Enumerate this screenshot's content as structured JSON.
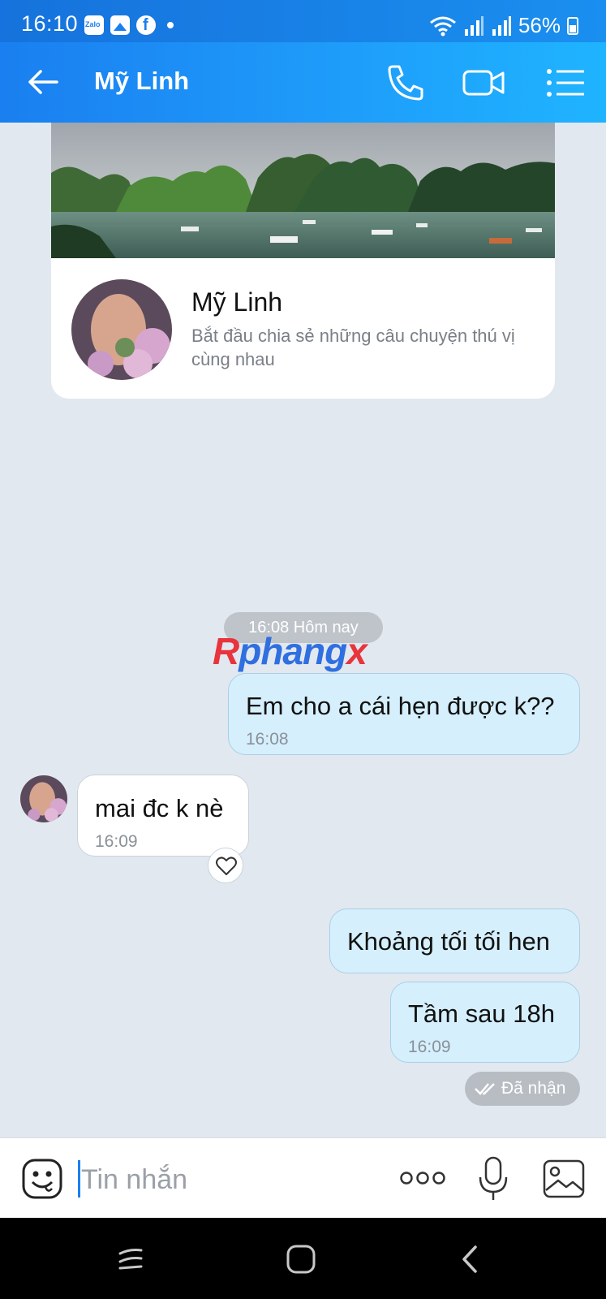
{
  "status_bar": {
    "time": "16:10",
    "battery": "56%",
    "notification_icons": [
      "zalo-icon",
      "gallery-icon",
      "facebook-icon"
    ]
  },
  "header": {
    "title": "Mỹ Linh"
  },
  "profile_card": {
    "name": "Mỹ Linh",
    "subtitle": "Bắt đầu chia sẻ những câu chuyện thú vị cùng nhau"
  },
  "chat": {
    "date_separator": "16:08 Hôm nay",
    "watermark": {
      "part1": "R",
      "part2": "phang",
      "part3": "x"
    },
    "messages": [
      {
        "direction": "outgoing",
        "text": "Em cho a cái hẹn được k??",
        "time": "16:08"
      },
      {
        "direction": "incoming",
        "text": "mai đc k nè",
        "time": "16:09"
      },
      {
        "direction": "outgoing",
        "text": "Khoảng tối tối hen",
        "time": ""
      },
      {
        "direction": "outgoing",
        "text": "Tầm sau 18h",
        "time": "16:09"
      }
    ],
    "delivery_status": "Đã nhận"
  },
  "input_bar": {
    "placeholder": "Tin nhắn"
  },
  "colors": {
    "header_gradient_start": "#1a7ff0",
    "header_gradient_end": "#1fb4ff",
    "chat_background": "#e2e8ef",
    "outgoing_bubble": "#d5effc",
    "incoming_bubble": "#ffffff"
  }
}
